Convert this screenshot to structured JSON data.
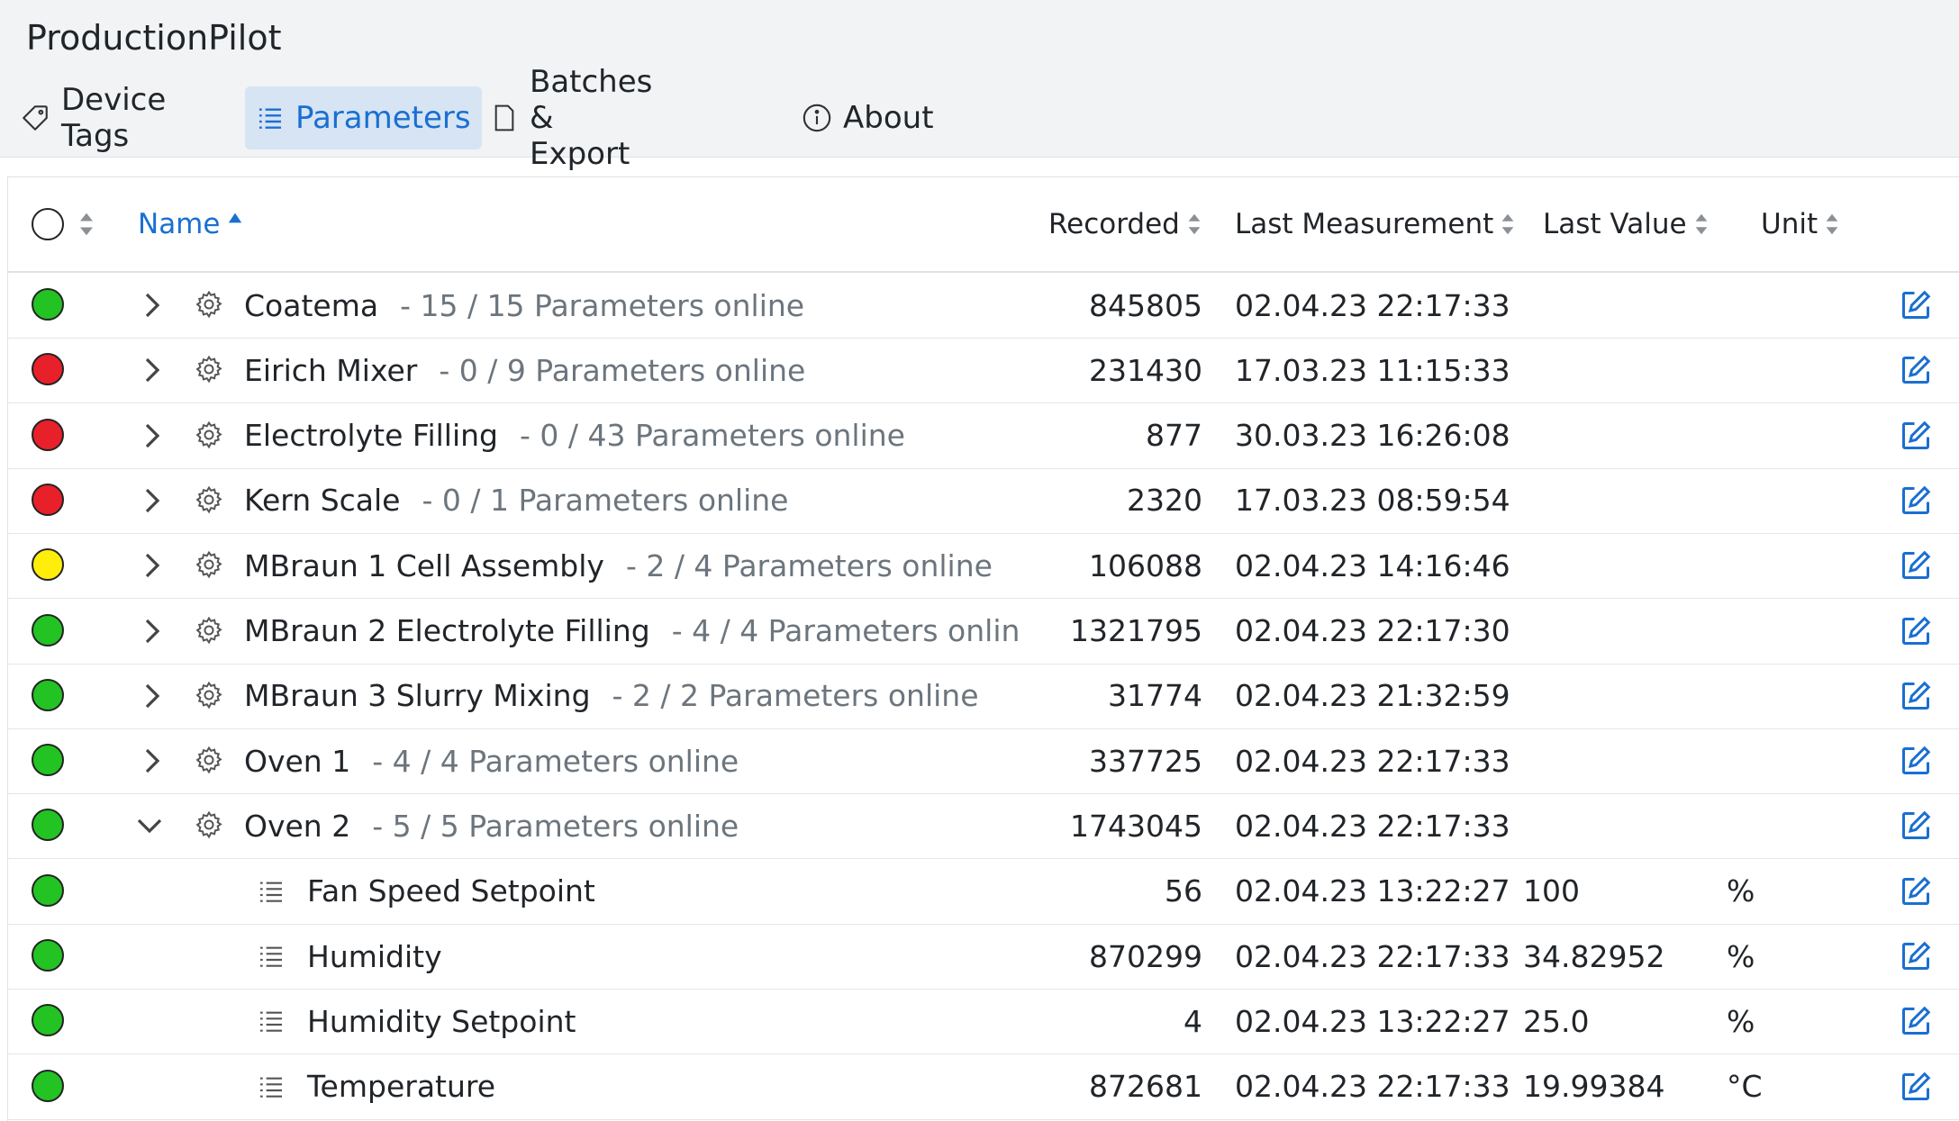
{
  "app": {
    "title": "ProductionPilot"
  },
  "nav": {
    "tabs": [
      {
        "label": "Device Tags",
        "icon": "tag-icon",
        "active": false
      },
      {
        "label": "Parameters",
        "icon": "list-icon",
        "active": true
      },
      {
        "label": "Batches & Export",
        "icon": "document-icon",
        "active": false
      },
      {
        "label": "About",
        "icon": "info-icon",
        "active": false
      }
    ]
  },
  "table": {
    "columns": {
      "name": "Name",
      "recorded": "Recorded",
      "last_measurement": "Last Measurement",
      "last_value": "Last Value",
      "unit": "Unit"
    },
    "status_colors": {
      "green": "#22c322",
      "red": "#e8202a",
      "yellow": "#ffee0a"
    },
    "accent": "#1a6fd1",
    "rows": [
      {
        "type": "device",
        "status": "green",
        "expanded": false,
        "name": "Coatema",
        "online": "- 15 / 15 Parameters online",
        "recorded": "845805",
        "last_measurement": "02.04.23 22:17:33",
        "last_value": "",
        "unit": ""
      },
      {
        "type": "device",
        "status": "red",
        "expanded": false,
        "name": "Eirich Mixer",
        "online": "- 0 / 9 Parameters online",
        "recorded": "231430",
        "last_measurement": "17.03.23 11:15:33",
        "last_value": "",
        "unit": ""
      },
      {
        "type": "device",
        "status": "red",
        "expanded": false,
        "name": "Electrolyte Filling",
        "online": "- 0 / 43 Parameters online",
        "recorded": "877",
        "last_measurement": "30.03.23 16:26:08",
        "last_value": "",
        "unit": ""
      },
      {
        "type": "device",
        "status": "red",
        "expanded": false,
        "name": "Kern Scale",
        "online": "- 0 / 1 Parameters online",
        "recorded": "2320",
        "last_measurement": "17.03.23 08:59:54",
        "last_value": "",
        "unit": ""
      },
      {
        "type": "device",
        "status": "yellow",
        "expanded": false,
        "name": "MBraun 1 Cell Assembly",
        "online": "- 2 / 4 Parameters online",
        "recorded": "106088",
        "last_measurement": "02.04.23 14:16:46",
        "last_value": "",
        "unit": ""
      },
      {
        "type": "device",
        "status": "green",
        "expanded": false,
        "name": "MBraun 2 Electrolyte Filling",
        "online": "- 4 / 4 Parameters onlin",
        "recorded": "1321795",
        "last_measurement": "02.04.23 22:17:30",
        "last_value": "",
        "unit": ""
      },
      {
        "type": "device",
        "status": "green",
        "expanded": false,
        "name": "MBraun 3 Slurry Mixing",
        "online": "- 2 / 2 Parameters online",
        "recorded": "31774",
        "last_measurement": "02.04.23 21:32:59",
        "last_value": "",
        "unit": ""
      },
      {
        "type": "device",
        "status": "green",
        "expanded": false,
        "name": "Oven 1",
        "online": "- 4 / 4 Parameters online",
        "recorded": "337725",
        "last_measurement": "02.04.23 22:17:33",
        "last_value": "",
        "unit": ""
      },
      {
        "type": "device",
        "status": "green",
        "expanded": true,
        "name": "Oven 2",
        "online": "- 5 / 5 Parameters online",
        "recorded": "1743045",
        "last_measurement": "02.04.23 22:17:33",
        "last_value": "",
        "unit": ""
      },
      {
        "type": "parameter",
        "status": "green",
        "name": "Fan Speed Setpoint",
        "online": "",
        "recorded": "56",
        "last_measurement": "02.04.23 13:22:27",
        "last_value": "100",
        "unit": "%"
      },
      {
        "type": "parameter",
        "status": "green",
        "name": "Humidity",
        "online": "",
        "recorded": "870299",
        "last_measurement": "02.04.23 22:17:33",
        "last_value": "34.82952",
        "unit": "%"
      },
      {
        "type": "parameter",
        "status": "green",
        "name": "Humidity Setpoint",
        "online": "",
        "recorded": "4",
        "last_measurement": "02.04.23 13:22:27",
        "last_value": "25.0",
        "unit": "%"
      },
      {
        "type": "parameter",
        "status": "green",
        "name": "Temperature",
        "online": "",
        "recorded": "872681",
        "last_measurement": "02.04.23 22:17:33",
        "last_value": "19.99384",
        "unit": "°C"
      }
    ]
  }
}
